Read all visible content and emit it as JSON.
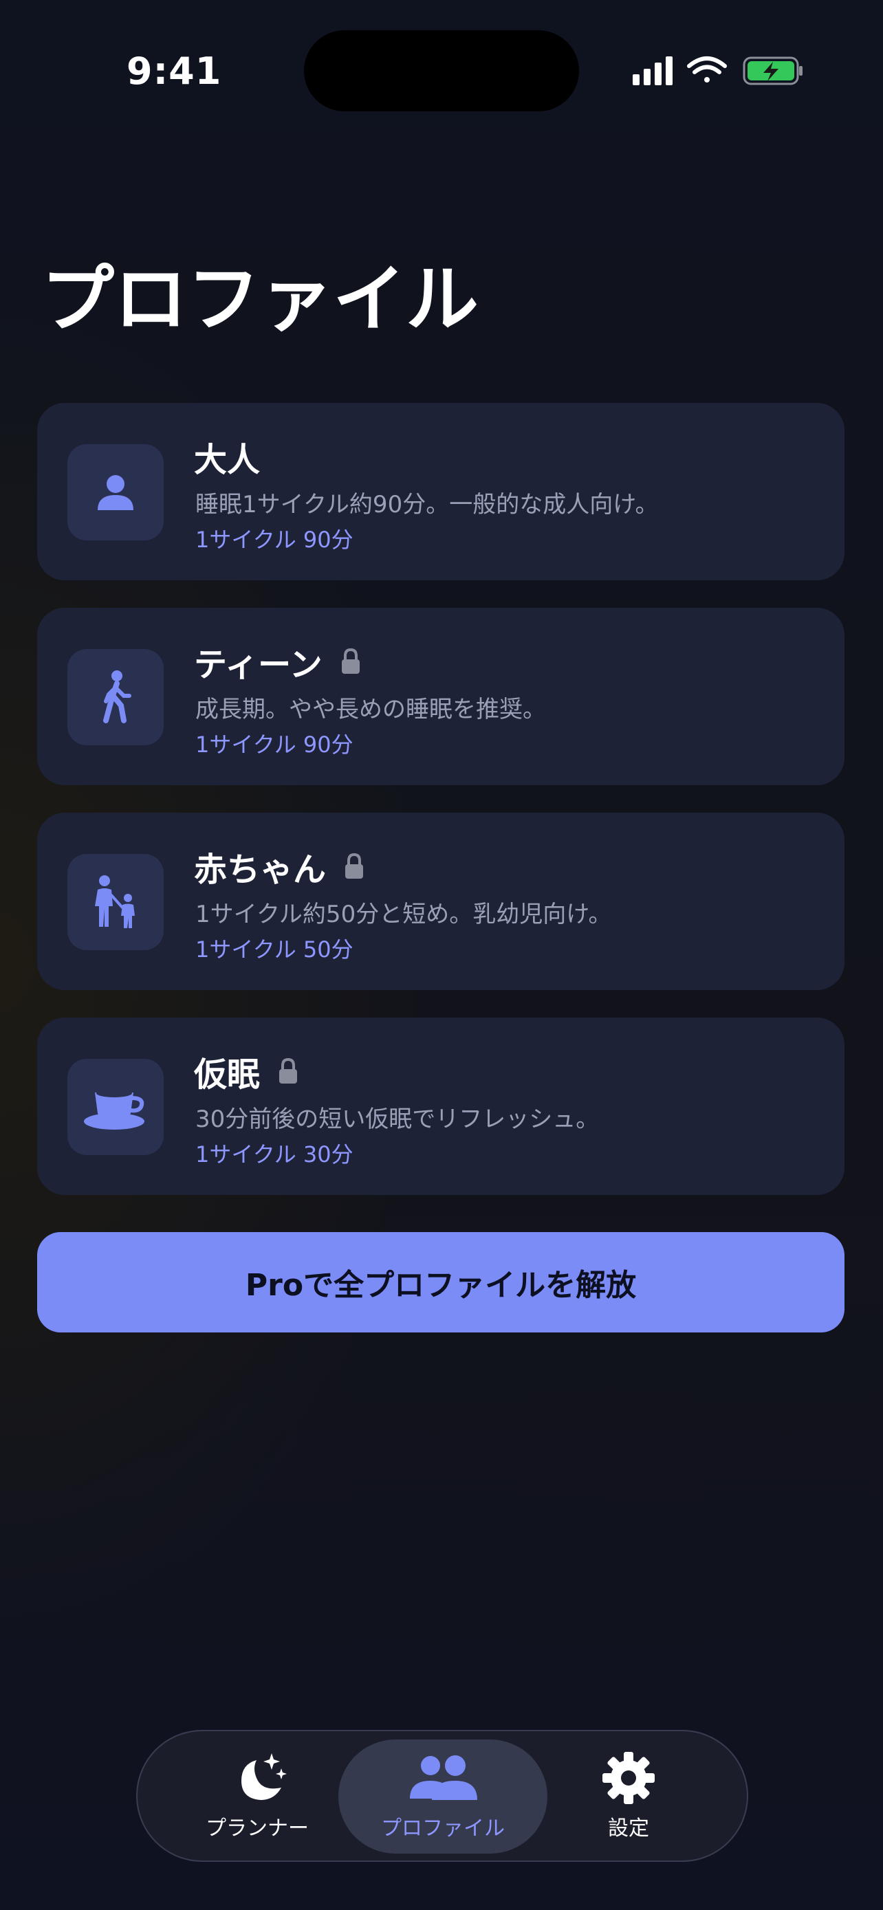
{
  "status_bar": {
    "time": "9:41"
  },
  "page": {
    "title": "プロファイル"
  },
  "profiles": [
    {
      "name": "大人",
      "description": "睡眠1サイクル約90分。一般的な成人向け。",
      "cycle": "1サイクル 90分",
      "icon": "person-icon",
      "locked": false
    },
    {
      "name": "ティーン",
      "description": "成長期。やや長めの睡眠を推奨。",
      "cycle": "1サイクル 90分",
      "icon": "walking-icon",
      "locked": true
    },
    {
      "name": "赤ちゃん",
      "description": "1サイクル約50分と短め。乳幼児向け。",
      "cycle": "1サイクル 50分",
      "icon": "parent-child-icon",
      "locked": true
    },
    {
      "name": "仮眠",
      "description": "30分前後の短い仮眠でリフレッシュ。",
      "cycle": "1サイクル 30分",
      "icon": "coffee-cup-icon",
      "locked": true
    }
  ],
  "pro_button": {
    "label": "Proで全プロファイルを解放"
  },
  "tab_bar": {
    "tabs": [
      {
        "label": "プランナー",
        "icon": "moon-stars-icon",
        "selected": false
      },
      {
        "label": "プロファイル",
        "icon": "people-icon",
        "selected": true
      },
      {
        "label": "設定",
        "icon": "gear-icon",
        "selected": false
      }
    ]
  },
  "colors": {
    "accent": "#7b8cf7",
    "accent_text": "#8d97ff",
    "card_bg": "#1e2236",
    "icon_box_bg": "#2a3050",
    "battery_green": "#34c759"
  }
}
